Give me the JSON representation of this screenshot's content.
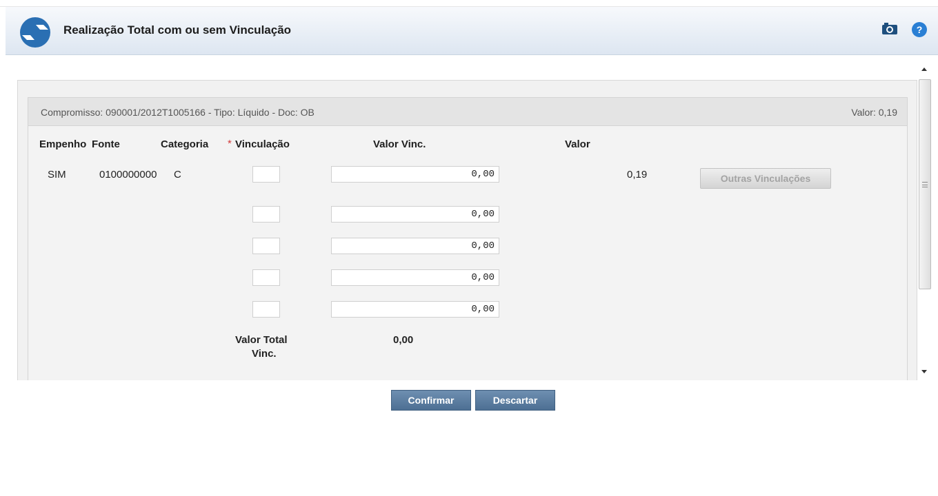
{
  "window": {
    "title": "Realização Total com ou sem Vinculação",
    "camera_icon": "camera-icon",
    "help_icon": "help-icon",
    "help_glyph": "?"
  },
  "header": {
    "compromisso_text": "Compromisso: 090001/2012T1005166 - Tipo: Líquido - Doc: OB",
    "valor_text": "Valor: 0,19"
  },
  "table": {
    "columns": {
      "empenho": "Empenho",
      "fonte": "Fonte",
      "categoria": "Categoria",
      "required_mark": "*",
      "vinculacao": "Vinculação",
      "valor_vinc": "Valor Vinc.",
      "valor": "Valor"
    },
    "row": {
      "empenho": "SIM",
      "fonte": "0100000000",
      "categoria": "C",
      "valor": "0,19",
      "outras_button": "Outras Vinculações"
    },
    "vinculacoes": [
      {
        "vinculacao": "",
        "valor_vinc": "0,00"
      },
      {
        "vinculacao": "",
        "valor_vinc": "0,00"
      },
      {
        "vinculacao": "",
        "valor_vinc": "0,00"
      },
      {
        "vinculacao": "",
        "valor_vinc": "0,00"
      },
      {
        "vinculacao": "",
        "valor_vinc": "0,00"
      }
    ],
    "total_label_line1": "Valor Total",
    "total_label_line2": "Vinc.",
    "total_value": "0,00"
  },
  "actions": {
    "confirm": "Confirmar",
    "discard": "Descartar"
  },
  "colors": {
    "accent": "#4d6f93",
    "required": "#d23a3a"
  }
}
